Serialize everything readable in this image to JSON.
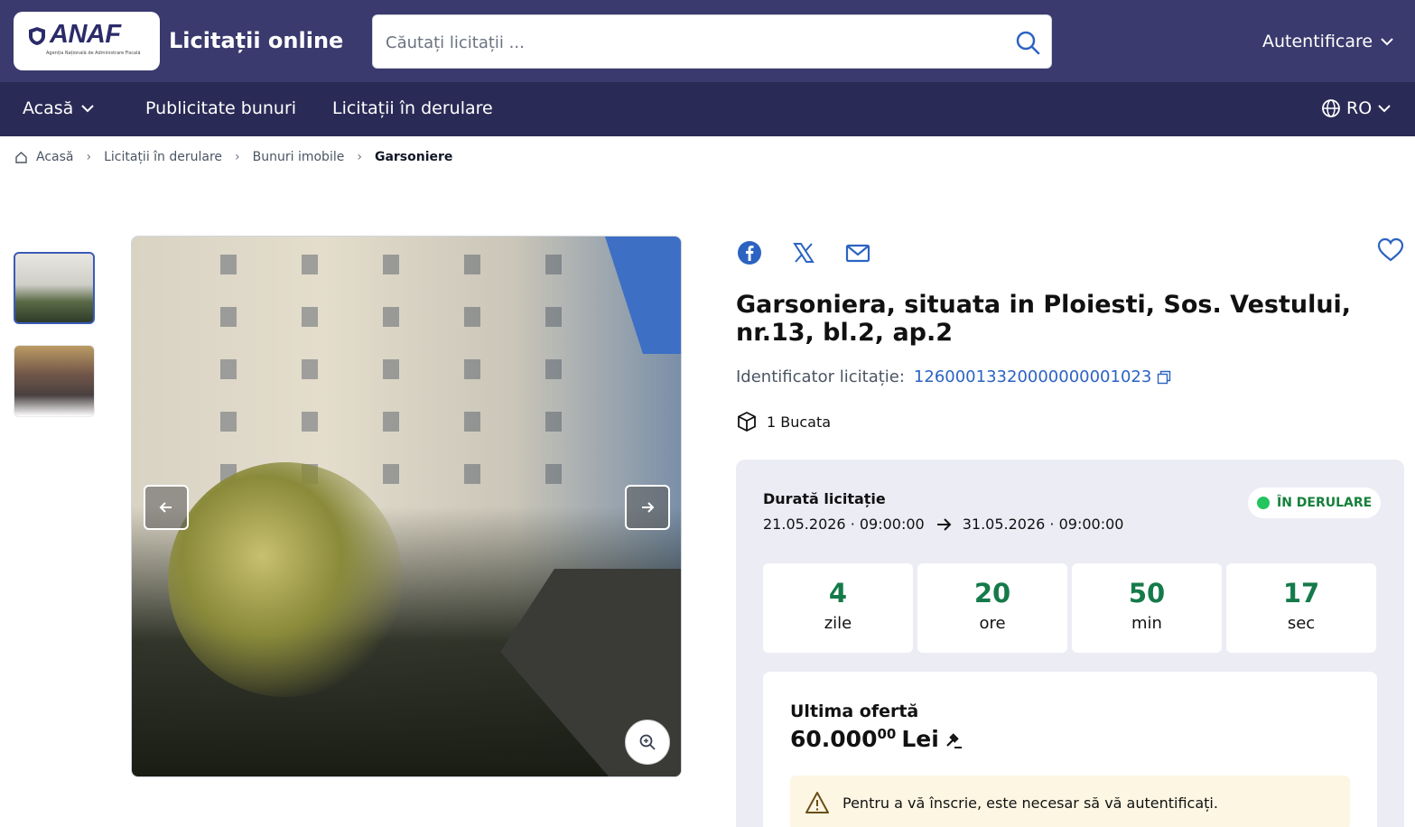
{
  "header": {
    "logo_text": "ANAF",
    "logo_subtitle": "Agenția Națională de Administrare Fiscală",
    "site_title": "Licitații online",
    "search_placeholder": "Căutați licitații ...",
    "auth_label": "Autentificare"
  },
  "nav": {
    "items": [
      {
        "label": "Acasă"
      },
      {
        "label": "Publicitate bunuri"
      },
      {
        "label": "Licitații în derulare"
      }
    ],
    "language": "RO"
  },
  "breadcrumb": [
    "Acasă",
    "Licitații în derulare",
    "Bunuri imobile",
    "Garsoniere"
  ],
  "listing": {
    "title": "Garsoniera, situata in Ploiesti, Sos. Vestului, nr.13, bl.2, ap.2",
    "identifier_label": "Identificator licitație:",
    "identifier_value": "12600013320000000001023",
    "quantity": "1 Bucata"
  },
  "auction": {
    "duration_label": "Durată licitație",
    "start": "21.05.2026 · 09:00:00",
    "end": "31.05.2026 · 09:00:00",
    "status": "ÎN DERULARE",
    "countdown": [
      {
        "value": "4",
        "unit": "zile"
      },
      {
        "value": "20",
        "unit": "ore"
      },
      {
        "value": "50",
        "unit": "min"
      },
      {
        "value": "17",
        "unit": "sec"
      }
    ]
  },
  "offer": {
    "label": "Ultima ofertă",
    "amount": "60.000",
    "decimals": "00",
    "currency": "Lei",
    "warning": "Pentru a vă înscrie, este necesar să vă autentificați."
  },
  "colors": {
    "header_bg": "#3a3a6e",
    "nav_bg": "#2a2a56",
    "accent_blue": "#2c63c2",
    "status_green": "#16803c"
  }
}
